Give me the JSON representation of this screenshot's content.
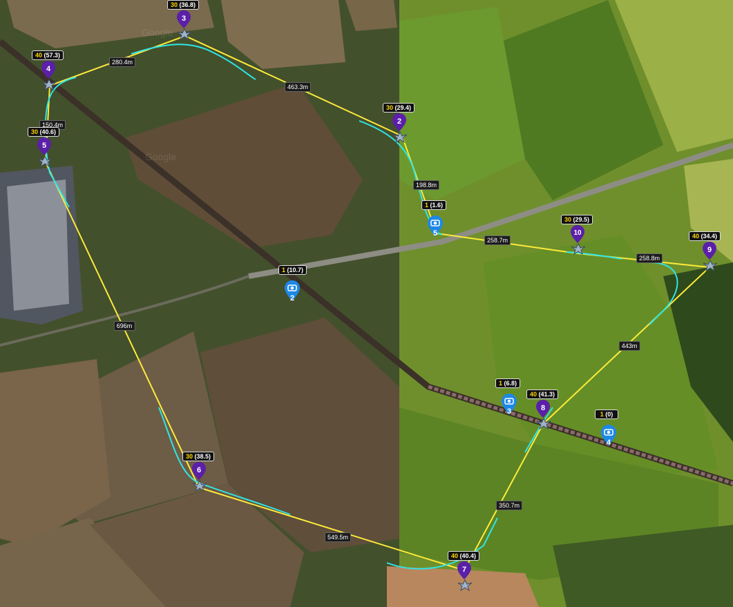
{
  "map": {
    "colors": {
      "path": "#ffeb3b",
      "curve": "#2ee6e6",
      "waypoint_pin": "#5b1fa8",
      "camera_pin": "#1e88e5"
    },
    "waypoints": [
      {
        "id": "2",
        "alt": "30",
        "rel": "(29.4)"
      },
      {
        "id": "3",
        "alt": "30",
        "rel": "(36.8)"
      },
      {
        "id": "4",
        "alt": "40",
        "rel": "(57.3)"
      },
      {
        "id": "5",
        "alt": "30",
        "rel": "(40.6)"
      },
      {
        "id": "6",
        "alt": "30",
        "rel": "(38.5)"
      },
      {
        "id": "7",
        "alt": "40",
        "rel": "(40.4)"
      },
      {
        "id": "8",
        "alt": "40",
        "rel": "(41.3)"
      },
      {
        "id": "9",
        "alt": "40",
        "rel": "(34.4)"
      },
      {
        "id": "10",
        "alt": "30",
        "rel": "(29.5)"
      }
    ],
    "camera_points": [
      {
        "id": "2",
        "alt": "1",
        "rel": "(10.7)"
      },
      {
        "id": "5",
        "alt": "1",
        "rel": "(1.6)"
      },
      {
        "id": "3",
        "alt": "1",
        "rel": "(6.8)"
      },
      {
        "id": "4",
        "alt": "1",
        "rel": "(0)"
      }
    ],
    "distances": [
      "280.4m",
      "463.3m",
      "150.4m",
      "198.8m",
      "258.7m",
      "258.8m",
      "696m",
      "443m",
      "549.5m",
      "350.7m"
    ],
    "watermark": "Google"
  }
}
